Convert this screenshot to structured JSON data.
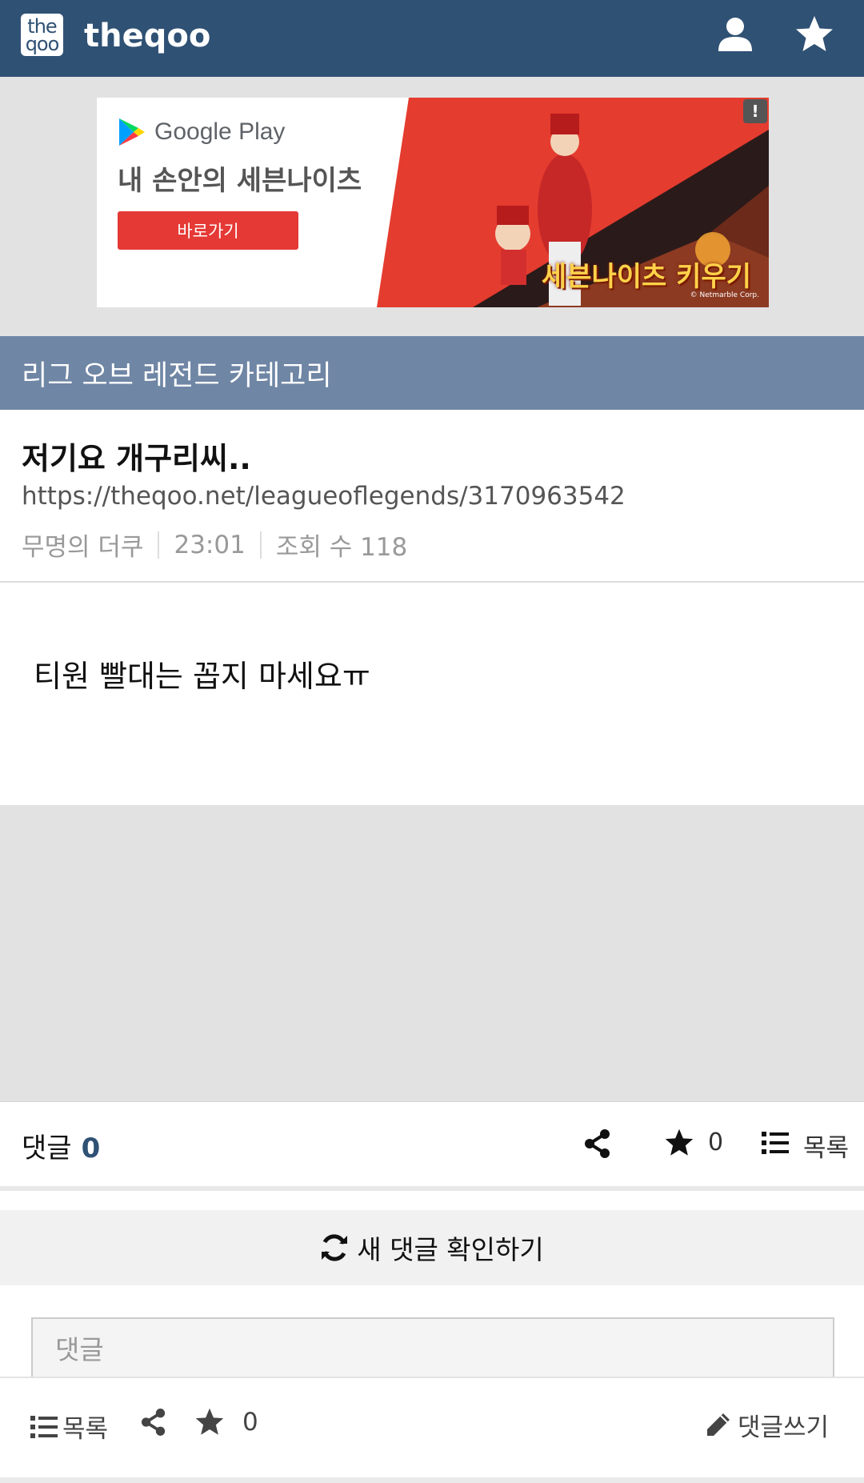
{
  "header": {
    "logo_top": "the",
    "logo_bottom": "qoo",
    "site_name": "theqoo",
    "icons": {
      "user": "user-icon",
      "favorites": "star-icon"
    },
    "bg_color": "#2f5174"
  },
  "ad": {
    "store_name": "Google Play",
    "headline": "내 손안의 세븐나이츠",
    "button_label": "바로가기",
    "info_badge": "!",
    "game_title": "세븐나이츠 키우기",
    "copyright": "© Netmarble Corp."
  },
  "category": {
    "label": "리그 오브 레전드 카테고리",
    "bg_color": "#6f86a5"
  },
  "post": {
    "title": "저기요 개구리씨..",
    "url": "https://theqoo.net/leagueoflegends/3170963542",
    "author": "무명의 더쿠",
    "time": "23:01",
    "views_label": "조회 수 118",
    "body": "티원 빨대는 꼽지 마세요ㅠ"
  },
  "comment_bar": {
    "label": "댓글",
    "count": "0",
    "star_count": "0",
    "list_label": "목록"
  },
  "refresh": {
    "label": "새 댓글 확인하기"
  },
  "comment_input": {
    "placeholder": "댓글"
  },
  "bottom_bar": {
    "list_label": "목록",
    "star_count": "0",
    "write_label": "댓글쓰기"
  }
}
